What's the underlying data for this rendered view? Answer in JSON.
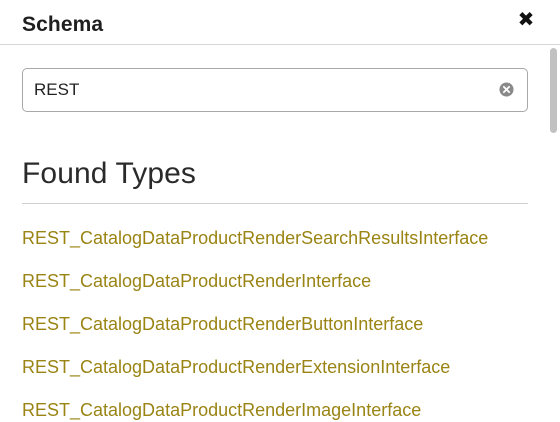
{
  "header": {
    "title": "Schema",
    "close_glyph": "✖"
  },
  "search": {
    "value": "REST",
    "clear_icon": "clear-circle-x"
  },
  "section": {
    "title": "Found Types"
  },
  "types": [
    "REST_CatalogDataProductRenderSearchResultsInterface",
    "REST_CatalogDataProductRenderInterface",
    "REST_CatalogDataProductRenderButtonInterface",
    "REST_CatalogDataProductRenderExtensionInterface",
    "REST_CatalogDataProductRenderImageInterface"
  ],
  "colors": {
    "link": "#9a8414",
    "title": "#1f1f1f"
  }
}
